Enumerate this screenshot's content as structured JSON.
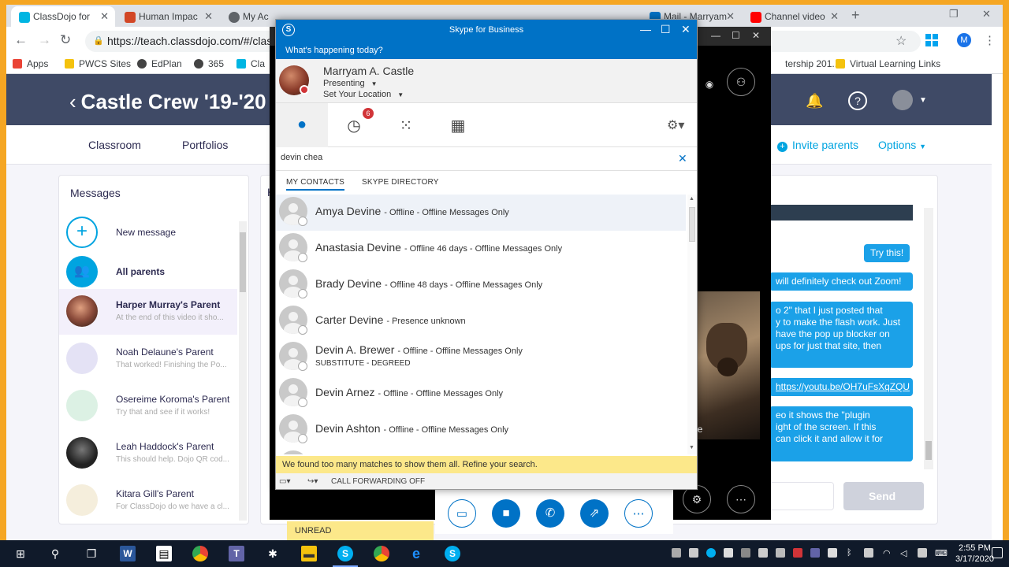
{
  "browser": {
    "tabs": [
      {
        "label": "ClassDojo for",
        "color": "#00b5e2"
      },
      {
        "label": "Human Impac",
        "color": "#d24726"
      },
      {
        "label": "My Ac",
        "color": "#5f6368"
      },
      {
        "label": "",
        "color": "#1a73e8"
      },
      {
        "label": "",
        "color": "#d24726"
      },
      {
        "label": "",
        "color": "#5f6368"
      },
      {
        "label": "Mail - Marryam",
        "color": "#0072c6"
      },
      {
        "label": "Channel video",
        "color": "#ff0000"
      }
    ],
    "url": "https://teach.classdojo.com/#/class",
    "profile_initial": "M",
    "bookmarks": [
      {
        "label": "Apps",
        "color": "#ea4335"
      },
      {
        "label": "PWCS Sites",
        "color": "#f4c20d"
      },
      {
        "label": "EdPlan",
        "color": "#444444"
      },
      {
        "label": "365",
        "color": "#444444"
      },
      {
        "label": "Cla",
        "color": "#00b5e2"
      },
      {
        "label": "tership 201...",
        "color": "#f4c20d"
      },
      {
        "label": "Virtual Learning Links",
        "color": "#f4c20d"
      }
    ]
  },
  "dojo": {
    "class_title": "Castle Crew '19-'20",
    "nav": {
      "classroom": "Classroom",
      "portfolios": "Portfolios",
      "invite": "Invite parents",
      "options": "Options"
    },
    "messages_title": "Messages",
    "new_message": "New message",
    "all_parents": "All parents",
    "threads": [
      {
        "name": "Harper Murray's Parent",
        "preview": "At the end of this video it sho...",
        "selected": true,
        "color": "#8a4a3a"
      },
      {
        "name": "Noah Delaune's Parent",
        "preview": "That worked! Finishing the Po...",
        "selected": false,
        "color": "#d8d8f0"
      },
      {
        "name": "Osereime Koroma's Parent",
        "preview": "Try that and see if it works!",
        "selected": false,
        "color": "#d6efe0"
      },
      {
        "name": "Leah Haddock's Parent",
        "preview": "This should help. Dojo QR cod...",
        "selected": false,
        "color": "#3a3a3a"
      },
      {
        "name": "Kitara Gill's Parent",
        "preview": "For ClassDojo do we have a cl...",
        "selected": false,
        "color": "#f3ead8"
      }
    ],
    "chat": {
      "header_initial": "H",
      "bubbles": [
        "Try this!",
        "will definitely check out Zoom!",
        "o 2\" that I just posted that\ny to make the flash work. Just\nhave the pop up blocker on\nups for just that site, then",
        "https://youtu.be/OH7uFsXqZQU",
        "eo it shows the \"plugin\night of the screen. If this\ncan click it and allow it for"
      ],
      "send": "Send"
    }
  },
  "call": {
    "video_label": "le",
    "unread": "UNREAD"
  },
  "skype": {
    "title": "Skype for Business",
    "whats_happening": "What's happening today?",
    "me": {
      "name": "Marryam A. Castle",
      "status": "Presenting",
      "location": "Set Your Location"
    },
    "recent_badge": "6",
    "search_value": "devin chea",
    "subtabs": {
      "contacts": "MY CONTACTS",
      "directory": "SKYPE DIRECTORY"
    },
    "contacts": [
      {
        "name": "Amya Devine",
        "status": "- Offline - Offline Messages Only",
        "sub": ""
      },
      {
        "name": "Anastasia Devine",
        "status": "- Offline 46 days - Offline Messages Only",
        "sub": ""
      },
      {
        "name": "Brady Devine",
        "status": "- Offline 48 days - Offline Messages Only",
        "sub": ""
      },
      {
        "name": "Carter Devine",
        "status": "- Presence unknown",
        "sub": ""
      },
      {
        "name": "Devin A. Brewer",
        "status": "- Offline - Offline Messages Only",
        "sub": "SUBSTITUTE - DEGREED"
      },
      {
        "name": "Devin Arnez",
        "status": "- Offline - Offline Messages Only",
        "sub": ""
      },
      {
        "name": "Devin Ashton",
        "status": "- Offline - Offline Messages Only",
        "sub": ""
      }
    ],
    "too_many": "We found too many matches to show them all. Refine your search.",
    "call_forwarding": "CALL FORWARDING OFF"
  },
  "taskbar": {
    "time": "2:55 PM",
    "date": "3/17/2020"
  }
}
